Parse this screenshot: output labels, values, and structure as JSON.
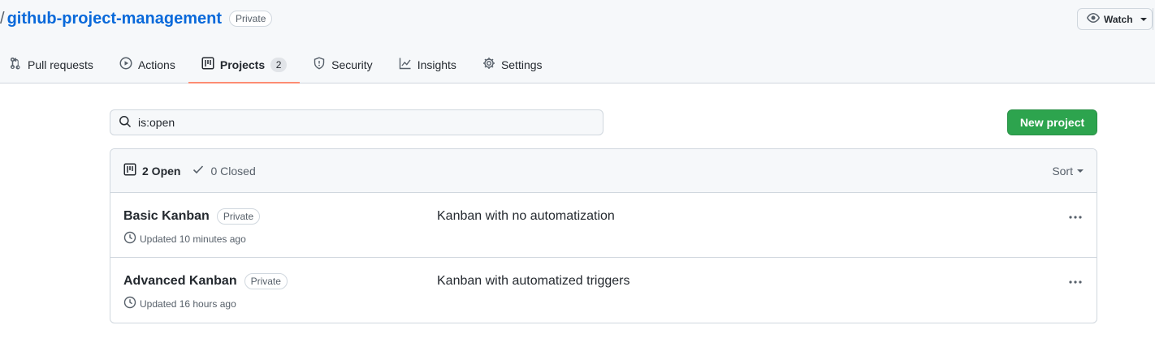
{
  "repo": {
    "separator": "/",
    "name": "github-project-management",
    "visibility": "Private"
  },
  "watch": {
    "label": "Watch"
  },
  "tabs": [
    {
      "label": "Pull requests",
      "icon": "git-pull-request-icon"
    },
    {
      "label": "Actions",
      "icon": "play-icon"
    },
    {
      "label": "Projects",
      "icon": "project-icon",
      "count": "2",
      "selected": true
    },
    {
      "label": "Security",
      "icon": "shield-icon"
    },
    {
      "label": "Insights",
      "icon": "graph-icon"
    },
    {
      "label": "Settings",
      "icon": "gear-icon"
    }
  ],
  "search": {
    "value": "is:open",
    "icon": "search-icon"
  },
  "new_project": {
    "label": "New project"
  },
  "filters": {
    "open_label": "2 Open",
    "closed_label": "0 Closed",
    "sort_label": "Sort"
  },
  "projects": [
    {
      "name": "Basic Kanban",
      "visibility": "Private",
      "updated": "Updated 10 minutes ago",
      "description": "Kanban with no automatization"
    },
    {
      "name": "Advanced Kanban",
      "visibility": "Private",
      "updated": "Updated 16 hours ago",
      "description": "Kanban with automatized triggers"
    }
  ],
  "colors": {
    "link": "#0969da",
    "primary_button": "#2da44e",
    "selected_tab_underline": "#fd8c73",
    "muted_text": "#57606a",
    "border": "#d0d7de"
  }
}
